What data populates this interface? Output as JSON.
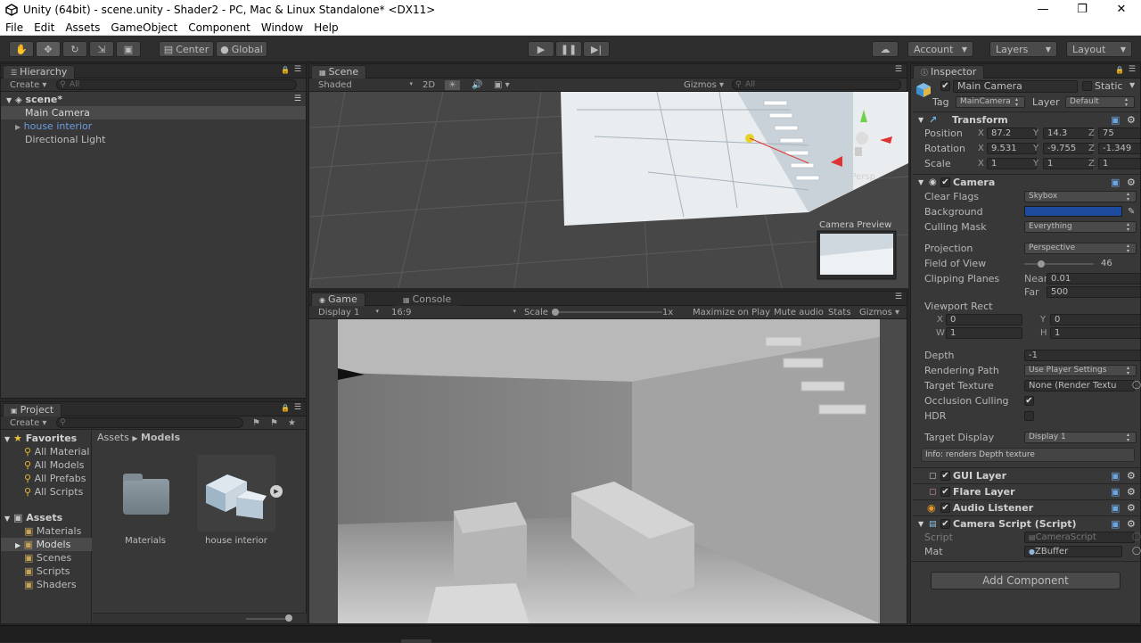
{
  "window": {
    "title": "Unity (64bit) - scene.unity - Shader2 - PC, Mac & Linux Standalone* <DX11>",
    "controls": [
      "—",
      "❐",
      "✕"
    ]
  },
  "menu": [
    "File",
    "Edit",
    "Assets",
    "GameObject",
    "Component",
    "Window",
    "Help"
  ],
  "toolbar": {
    "pivot": "Center",
    "space": "Global",
    "account": "Account",
    "layers": "Layers",
    "layout": "Layout"
  },
  "hierarchy": {
    "tab": "Hierarchy",
    "create": "Create",
    "search_placeholder": "All",
    "scene": "scene*",
    "items": [
      "Main Camera",
      "house interior",
      "Directional Light"
    ]
  },
  "scene": {
    "tab": "Scene",
    "shading": "Shaded",
    "mode2d": "2D",
    "gizmos": "Gizmos",
    "search_placeholder": "All",
    "persp": "< Persp",
    "camera_preview": "Camera Preview"
  },
  "game": {
    "tab": "Game",
    "console_tab": "Console",
    "display": "Display 1",
    "aspect": "16:9",
    "scale_label": "Scale",
    "scale_value": "1x",
    "maximize": "Maximize on Play",
    "mute": "Mute audio",
    "stats": "Stats",
    "gizmos": "Gizmos"
  },
  "project": {
    "tab": "Project",
    "create": "Create",
    "favorites_label": "Favorites",
    "favorites": [
      "All Material",
      "All Models",
      "All Prefabs",
      "All Scripts"
    ],
    "assets_label": "Assets",
    "assets": [
      "Materials",
      "Models",
      "Scenes",
      "Scripts",
      "Shaders"
    ],
    "breadcrumb": [
      "Assets",
      "Models"
    ],
    "grid_items": [
      "Materials",
      "house interior"
    ]
  },
  "inspector": {
    "tab": "Inspector",
    "object_name": "Main Camera",
    "static_label": "Static",
    "tag_label": "Tag",
    "tag_value": "MainCamera",
    "layer_label": "Layer",
    "layer_value": "Default",
    "transform": {
      "title": "Transform",
      "position_label": "Position",
      "position": {
        "x": "87.2",
        "y": "14.3",
        "z": "75"
      },
      "rotation_label": "Rotation",
      "rotation": {
        "x": "9.531",
        "y": "-9.755",
        "z": "-1.349"
      },
      "scale_label": "Scale",
      "scale": {
        "x": "1",
        "y": "1",
        "z": "1"
      }
    },
    "camera": {
      "title": "Camera",
      "clear_flags_label": "Clear Flags",
      "clear_flags": "Skybox",
      "background_label": "Background",
      "background_color": "#1d4a9c",
      "culling_mask_label": "Culling Mask",
      "culling_mask": "Everything",
      "projection_label": "Projection",
      "projection": "Perspective",
      "fov_label": "Field of View",
      "fov": "46",
      "clipping_label": "Clipping Planes",
      "near_label": "Near",
      "near": "0.01",
      "far_label": "Far",
      "far": "500",
      "viewport_label": "Viewport Rect",
      "vx": "0",
      "vy": "0",
      "vw": "1",
      "vh": "1",
      "depth_label": "Depth",
      "depth": "-1",
      "rendering_path_label": "Rendering Path",
      "rendering_path": "Use Player Settings",
      "target_texture_label": "Target Texture",
      "target_texture": "None (Render Textu",
      "occlusion_label": "Occlusion Culling",
      "hdr_label": "HDR",
      "target_display_label": "Target Display",
      "target_display": "Display 1",
      "info": "Info: renders Depth texture"
    },
    "components": [
      "GUI Layer",
      "Flare Layer",
      "Audio Listener",
      "Camera Script (Script)"
    ],
    "script_label": "Script",
    "script_value": "CameraScript",
    "mat_label": "Mat",
    "mat_value": "ZBuffer",
    "add_component": "Add Component"
  }
}
